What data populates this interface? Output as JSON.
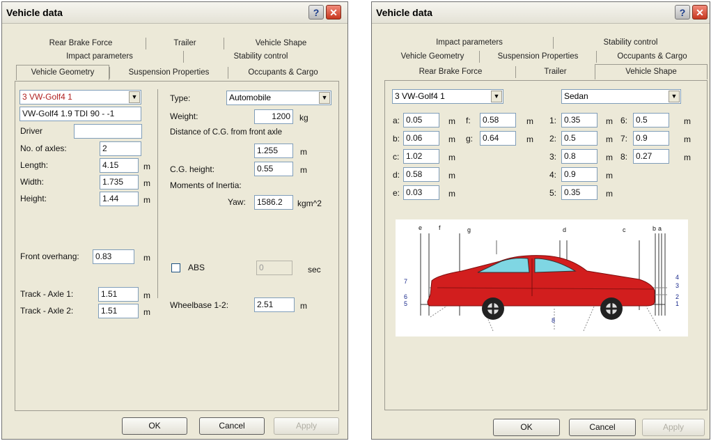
{
  "left": {
    "title": "Vehicle data",
    "tabs_row1": [
      "Rear Brake Force",
      "Trailer",
      "Vehicle Shape"
    ],
    "tabs_row2": [
      "Impact parameters",
      "Stability control"
    ],
    "tabs_row3": [
      "Vehicle Geometry",
      "Suspension Properties",
      "Occupants & Cargo"
    ],
    "vehicle_combo": "3 VW-Golf4 1",
    "vehicle_name": "VW-Golf4 1.9 TDI 90 - -1",
    "driver_label": "Driver",
    "driver_value": "",
    "axles_label": "No. of axles:",
    "axles_value": "2",
    "length_label": "Length:",
    "length_value": "4.15",
    "width_label": "Width:",
    "width_value": "1.735",
    "height_label": "Height:",
    "height_value": "1.44",
    "overhang_label": "Front overhang:",
    "overhang_value": "0.83",
    "track1_label": "Track - Axle 1:",
    "track1_value": "1.51",
    "track2_label": "Track - Axle 2:",
    "track2_value": "1.51",
    "type_label": "Type:",
    "type_value": "Automobile",
    "weight_label": "Weight:",
    "weight_value": "1200",
    "weight_unit": "kg",
    "cg_dist_label": "Distance of C.G. from front axle",
    "cg_dist_value": "1.255",
    "cg_height_label": "C.G. height:",
    "cg_height_value": "0.55",
    "moi_label": "Moments of Inertia:",
    "yaw_label": "Yaw:",
    "yaw_value": "1586.2",
    "yaw_unit": "kgm^2",
    "abs_label": "ABS",
    "abs_value": "0",
    "abs_unit": "sec",
    "wheelbase_label": "Wheelbase 1-2:",
    "wheelbase_value": "2.51",
    "unit_m": "m",
    "ok": "OK",
    "cancel": "Cancel",
    "apply": "Apply"
  },
  "right": {
    "title": "Vehicle data",
    "tabs_row1": [
      "Impact parameters",
      "Stability control"
    ],
    "tabs_row2": [
      "Vehicle Geometry",
      "Suspension Properties",
      "Occupants & Cargo"
    ],
    "tabs_row3": [
      "Rear Brake Force",
      "Trailer",
      "Vehicle Shape"
    ],
    "vehicle_combo": "3 VW-Golf4 1",
    "shape_combo": "Sedan",
    "params": [
      {
        "label": "a:",
        "value": "0.05"
      },
      {
        "label": "b:",
        "value": "0.06"
      },
      {
        "label": "c:",
        "value": "1.02"
      },
      {
        "label": "d:",
        "value": "0.58"
      },
      {
        "label": "e:",
        "value": "0.03"
      },
      {
        "label": "f:",
        "value": "0.58"
      },
      {
        "label": "g:",
        "value": "0.64"
      },
      {
        "label": "1:",
        "value": "0.35"
      },
      {
        "label": "2:",
        "value": "0.5"
      },
      {
        "label": "3:",
        "value": "0.8"
      },
      {
        "label": "4:",
        "value": "0.9"
      },
      {
        "label": "5:",
        "value": "0.35"
      },
      {
        "label": "6:",
        "value": "0.5"
      },
      {
        "label": "7:",
        "value": "0.9"
      },
      {
        "label": "8:",
        "value": "0.27"
      }
    ],
    "unit_m": "m",
    "diagram_letters": [
      "e",
      "f",
      "g",
      "d",
      "c",
      "b",
      "a"
    ],
    "diagram_numbers": [
      "7",
      "6",
      "5",
      "4",
      "3",
      "2",
      "1",
      "8"
    ],
    "ok": "OK",
    "cancel": "Cancel",
    "apply": "Apply"
  },
  "colors": {
    "car_body": "#d21e1e",
    "car_glass": "#7fd6e3",
    "title_close": "#c7371f"
  },
  "icons": [
    "help-icon",
    "close-icon",
    "chevron-down-icon",
    "checkbox"
  ]
}
